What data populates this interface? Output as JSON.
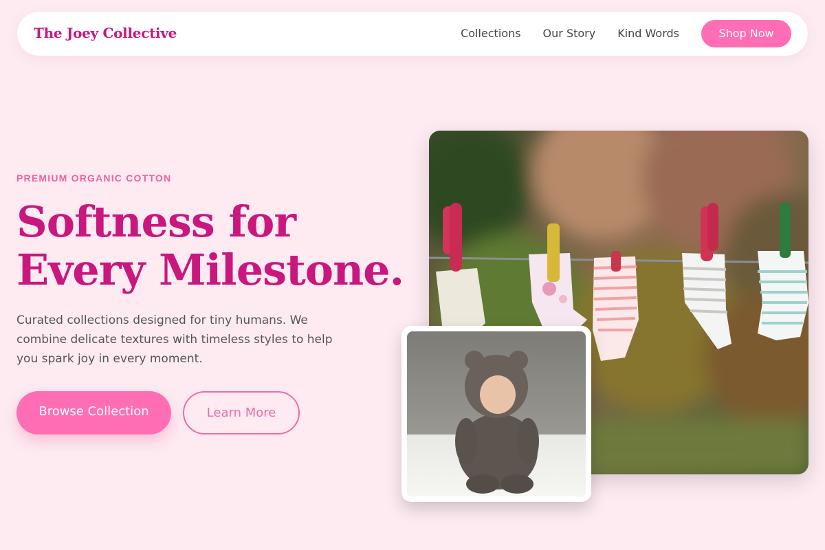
{
  "nav": {
    "brand": "The Joey Collective",
    "links": [
      "Collections",
      "Our Story",
      "Kind Words"
    ],
    "cta": "Shop Now"
  },
  "hero": {
    "eyebrow": "PREMIUM ORGANIC COTTON",
    "headline_line1": "Softness for",
    "headline_line2": "Every Milestone.",
    "description": "Curated collections designed for tiny humans. We combine delicate textures with timeless styles to help you spark joy in every moment.",
    "primary_button": "Browse Collection",
    "secondary_button": "Learn More"
  },
  "images": {
    "main": "baby-socks-on-clothesline",
    "secondary": "baby-in-bear-hoodie"
  },
  "colors": {
    "background": "#fdebf1",
    "brand": "#c8177d",
    "accent": "#ff6eb4"
  }
}
